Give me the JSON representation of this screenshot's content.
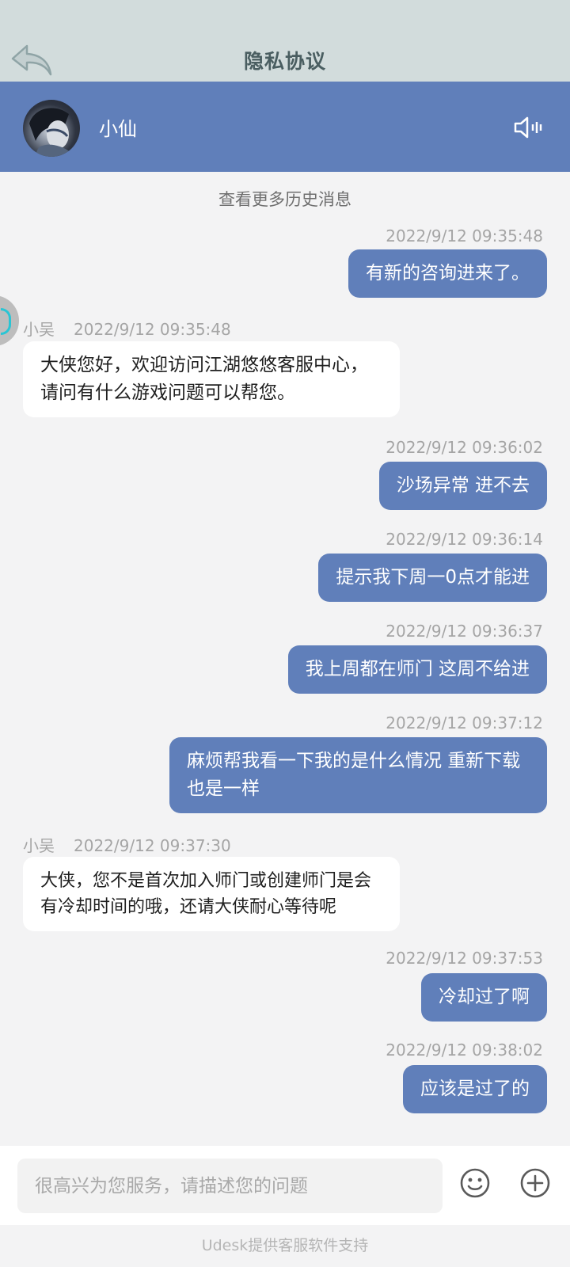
{
  "header": {
    "title": "隐私协议",
    "back_icon": "back-arrow-icon"
  },
  "agent_bar": {
    "agent_name": "小仙",
    "sound_icon": "speaker-icon"
  },
  "chat": {
    "more_history": "查看更多历史消息",
    "messages": [
      {
        "dir": "out",
        "time": "2022/9/12 09:35:48",
        "text": "有新的咨询进来了。"
      },
      {
        "dir": "in",
        "sender": "小吴",
        "time": "2022/9/12 09:35:48",
        "text": "大侠您好，欢迎访问江湖悠悠客服中心，请问有什么游戏问题可以帮您。"
      },
      {
        "dir": "out",
        "time": "2022/9/12 09:36:02",
        "text": "沙场异常 进不去"
      },
      {
        "dir": "out",
        "time": "2022/9/12 09:36:14",
        "text": "提示我下周一0点才能进"
      },
      {
        "dir": "out",
        "time": "2022/9/12 09:36:37",
        "text": "我上周都在师门 这周不给进"
      },
      {
        "dir": "out",
        "time": "2022/9/12 09:37:12",
        "text": "麻烦帮我看一下我的是什么情况 重新下载也是一样"
      },
      {
        "dir": "in",
        "sender": "小吴",
        "time": "2022/9/12 09:37:30",
        "text": "大侠，您不是首次加入师门或创建师门是会有冷却时间的哦，还请大侠耐心等待呢"
      },
      {
        "dir": "out",
        "time": "2022/9/12 09:37:53",
        "text": "冷却过了啊"
      },
      {
        "dir": "out",
        "time": "2022/9/12 09:38:02",
        "text": "应该是过了的"
      }
    ]
  },
  "composer": {
    "placeholder": "很高兴为您服务，请描述您的问题",
    "emoji_icon": "smiley-icon",
    "plus_icon": "plus-circle-icon"
  },
  "footer": {
    "note": "Udesk提供客服软件支持"
  },
  "colors": {
    "agent_bar": "#607fba",
    "outgoing_bubble": "#607fba",
    "header_bg": "#d2dcdc",
    "chat_bg": "#f3f3f4"
  }
}
